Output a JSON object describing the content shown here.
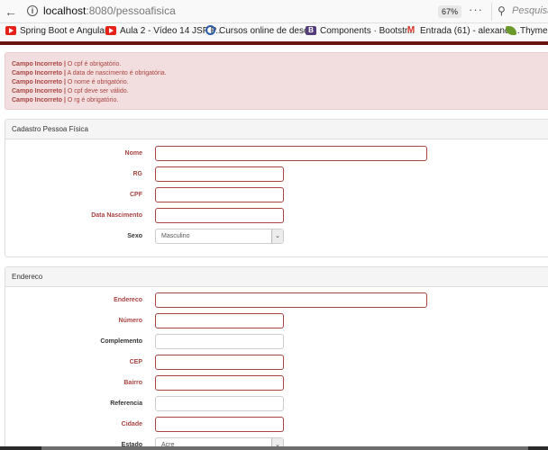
{
  "browser": {
    "url_host": "localhost",
    "url_rest": ":8080/pessoafisica",
    "zoom": "67%",
    "more": "···",
    "search_placeholder": "Pesquisar",
    "bookmarks": [
      {
        "label": "Spring Boot e Angular...",
        "icon": "youtube-icon"
      },
      {
        "label": "Aula 2 - Vídeo 14 JSF P...",
        "icon": "youtube-icon"
      },
      {
        "label": "Cursos online de dese...",
        "icon": "circle-icon"
      },
      {
        "label": "Components · Bootstr...",
        "icon": "bootstrap-icon"
      },
      {
        "label": "Entrada (61) - alexandr...",
        "icon": "gmail-icon"
      },
      {
        "label": "Thymele",
        "icon": "thymeleaf-icon"
      }
    ]
  },
  "alert": {
    "lines": [
      {
        "strong": "Campo Incorreto |",
        "text": " O cpf é obrigatório."
      },
      {
        "strong": "Campo Incorreto |",
        "text": " A data de nascimento é obrigatória."
      },
      {
        "strong": "Campo Incorreto |",
        "text": " O nome é obrigatório."
      },
      {
        "strong": "Campo Incorreto |",
        "text": " O cpf deve ser válido."
      },
      {
        "strong": "Campo Incorreto |",
        "text": " O rg é obrigatório."
      }
    ]
  },
  "pessoa": {
    "title": "Cadastro Pessoa Física",
    "nome_label": "Nome",
    "rg_label": "RG",
    "cpf_label": "CPF",
    "nascimento_label": "Data Nascimento",
    "sexo_label": "Sexo",
    "sexo_value": "Masculino"
  },
  "endereco": {
    "title": "Endereco",
    "endereco_label": "Endereco",
    "numero_label": "Número",
    "complemento_label": "Complemento",
    "cep_label": "CEP",
    "bairro_label": "Bairro",
    "referencia_label": "Referencia",
    "cidade_label": "Cidade",
    "estado_label": "Estado",
    "estado_value": "Acre"
  },
  "colors": {
    "error": "#a94442",
    "alert_bg": "#f2dede",
    "panel_heading_bg": "#f5f5f5"
  }
}
